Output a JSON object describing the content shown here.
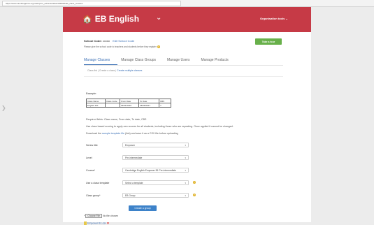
{
  "browser": {
    "url": "https://www.cambridgelms.org/main/p/ns_administration/00000/bulk_class_creation"
  },
  "header": {
    "brand": "EB English",
    "org_tools": "Organisation tools"
  },
  "school": {
    "label": "School Code:",
    "code": "zxxsn",
    "edit_link": "Edit School Code",
    "note": "Please give the school code to teachers and students before they register",
    "tour_button": "Take a tour"
  },
  "tabs": [
    "Manage Classes",
    "Manage Class Groups",
    "Manage Users",
    "Manage Products"
  ],
  "subnav": {
    "item1": "Class list",
    "sep1": "|",
    "item2": "Create a class",
    "sep2": "|",
    "item3": "Create multiple classes"
  },
  "example": {
    "title": "Example:",
    "headers": [
      "Class Name",
      "Class Code",
      "From Date",
      "To Date",
      "CBS"
    ],
    "row": [
      "English 101",
      "",
      "03/01/2016",
      "18/06/2017",
      "Y"
    ]
  },
  "notes": {
    "required": "Required fields: Class name, From date, To date, CBS",
    "cbs": "Use class based scoring to apply zero scores for all students, including those who are repeating. Once applied it cannot be changed.",
    "download_pre": "Download the ",
    "download_link": "sample template file",
    "download_post": " (link) and save it as a CSV file before uploading"
  },
  "form": {
    "series_label": "Series title",
    "series_value": "Empower",
    "level_label": "Level",
    "level_value": "Pre-intermediate",
    "course_label": "Course*",
    "course_value": "Cambridge English Empower B1 Pre-intermediate",
    "template_label": "Use a class template",
    "template_value": "Select a template",
    "group_label": "Class group*",
    "group_value": "EB Group",
    "help": "?",
    "caret": "▾",
    "create_button": "Create a group",
    "file_asterisk": "*",
    "file_button": "Choose File",
    "file_status": "No file chosen",
    "attached_file": "Empower B1.csv"
  }
}
